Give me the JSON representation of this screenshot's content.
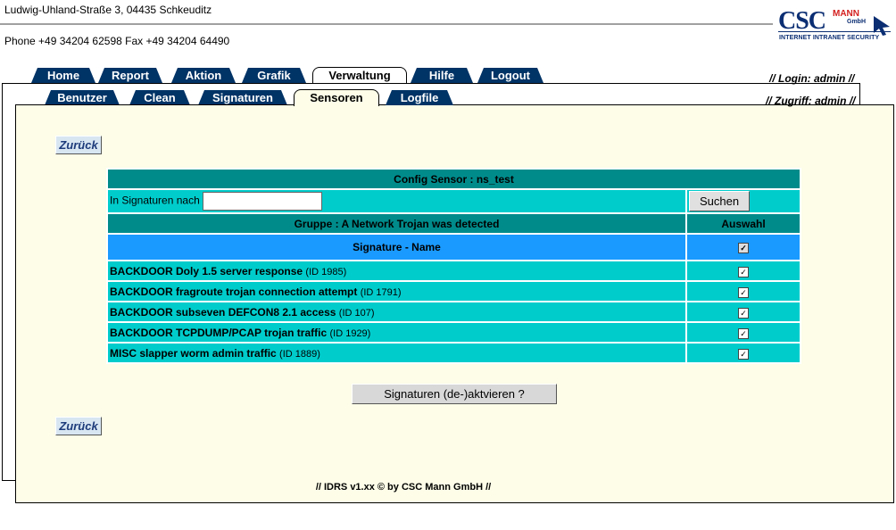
{
  "header": {
    "address": "Ludwig-Uhland-Straße 3, 04435 Schkeuditz",
    "phone": "Phone +49 34204 62598 Fax +49 34204 64490"
  },
  "logo": {
    "csc": "CSC",
    "mann": "MANN",
    "gmbh": "GmbH",
    "tagline": "INTERNET INTRANET SECURITY"
  },
  "main_tabs": [
    "Home",
    "Report",
    "Aktion",
    "Grafik",
    "Verwaltung",
    "Hilfe",
    "Logout"
  ],
  "main_active": "Verwaltung",
  "sub_tabs": [
    "Benutzer",
    "Clean",
    "Signaturen",
    "Sensoren",
    "Logfile"
  ],
  "sub_active": "Sensoren",
  "login": {
    "prefix": "// Login:",
    "user": "admin",
    "suffix": "//"
  },
  "zugriff": {
    "prefix": "// Zugriff:",
    "user": "admin",
    "suffix": "//"
  },
  "back_label": "Zurück",
  "table": {
    "title": "Config Sensor : ns_test",
    "search_label": "In Signaturen nach",
    "search_value": "",
    "search_button": "Suchen",
    "group": "Gruppe : A Network Trojan was detected",
    "select_header": "Auswahl",
    "name_header": "Signature - Name",
    "rows": [
      {
        "name": "BACKDOOR Doly 1.5 server response",
        "id": "(ID 1985)",
        "checked": true
      },
      {
        "name": "BACKDOOR fragroute trojan connection attempt",
        "id": "(ID 1791)",
        "checked": true
      },
      {
        "name": "BACKDOOR subseven DEFCON8 2.1 access",
        "id": "(ID 107)",
        "checked": true
      },
      {
        "name": "BACKDOOR TCPDUMP/PCAP trojan traffic",
        "id": "(ID 1929)",
        "checked": true
      },
      {
        "name": "MISC slapper worm admin traffic",
        "id": "(ID 1889)",
        "checked": true
      }
    ]
  },
  "toggle_button": "Signaturen (de-)aktvieren ?",
  "footer": "//  IDRS v1.xx © by CSC Mann GmbH   //",
  "colors": {
    "tab": "#003366",
    "teal": "#008b8b",
    "cyan": "#00cccc",
    "blue": "#1a9aff",
    "panel": "#fdfde8"
  }
}
